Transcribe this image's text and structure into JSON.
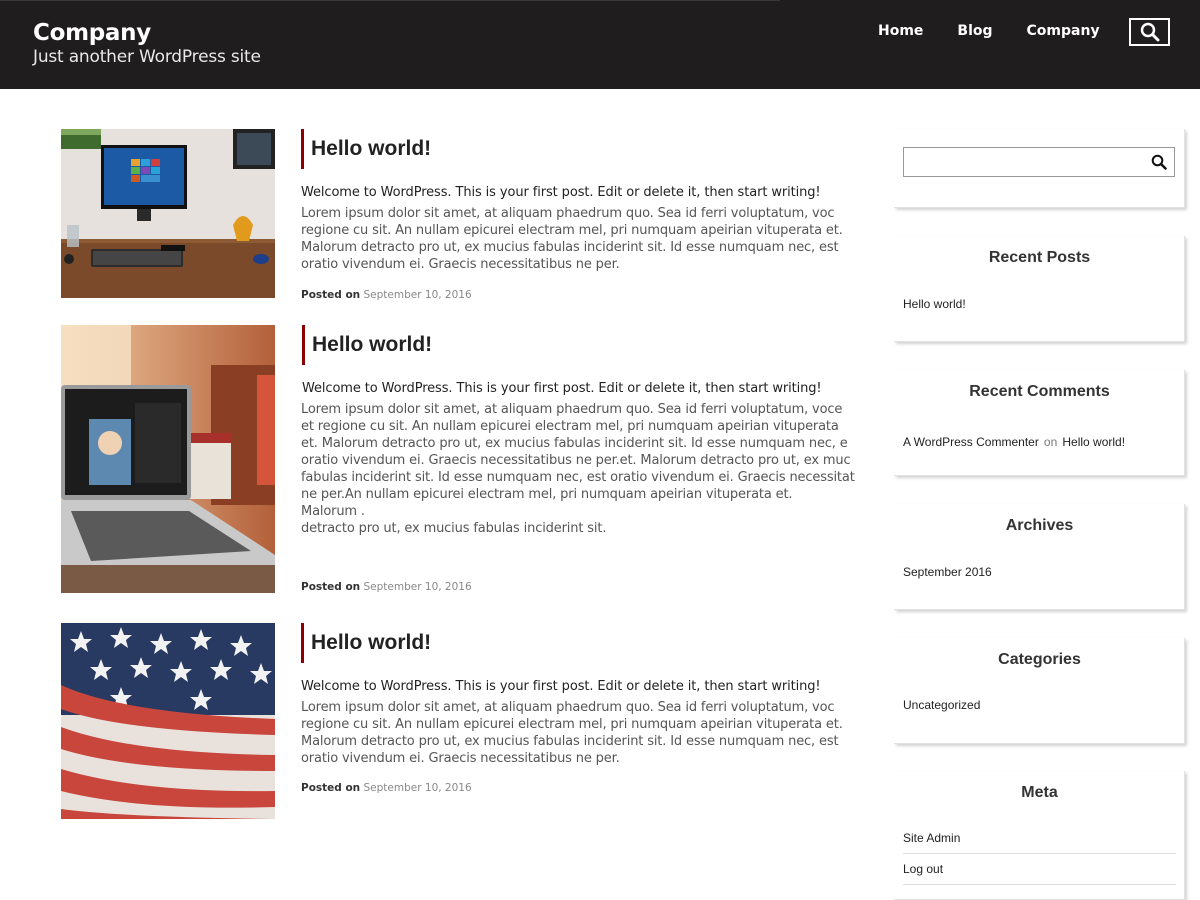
{
  "site": {
    "title": "Company",
    "tagline": "Just another WordPress site"
  },
  "nav": {
    "items": [
      "Home",
      "Blog",
      "Company"
    ],
    "search_icon": "search-icon"
  },
  "posts": [
    {
      "title": "Hello world!",
      "intro": "Welcome to WordPress. This is your first post. Edit or delete it, then start writing!",
      "body": "Lorem ipsum dolor sit amet, at aliquam phaedrum quo. Sea id ferri voluptatum, voc regione cu sit. An nullam epicurei electram mel, pri numquam apeirian vituperata et. Malorum detracto pro ut, ex mucius fabulas inciderint sit. Id esse numquam nec, est oratio vivendum ei. Graecis necessitatibus ne per.",
      "meta_label": "Posted on",
      "date": "September 10, 2016",
      "image": "desktop computer on wooden desk"
    },
    {
      "title": "Hello world!",
      "intro": "Welcome to WordPress. This is your first post. Edit or delete it, then start writing!",
      "body": "Lorem ipsum dolor sit amet, at aliquam phaedrum quo. Sea id ferri voluptatum, voce\net regione cu sit. An nullam epicurei electram mel, pri numquam apeirian vituperata\net. Malorum detracto pro ut, ex mucius fabulas inciderint sit. Id esse numquam nec, e\noratio vivendum ei. Graecis necessitatibus ne per.et. Malorum detracto pro ut, ex muc\nfabulas inciderint sit. Id esse numquam nec, est oratio vivendum ei. Graecis necessitat\nne per.An nullam epicurei electram mel, pri numquam apeirian vituperata et.\nMalorum .\ndetracto pro ut, ex mucius fabulas inciderint sit.",
      "meta_label": "Posted on",
      "date": "September 10, 2016",
      "image": "laptop on desk with calendar"
    },
    {
      "title": "Hello world!",
      "intro": "Welcome to WordPress. This is your first post. Edit or delete it, then start writing!",
      "body": "Lorem ipsum dolor sit amet, at aliquam phaedrum quo. Sea id ferri voluptatum, voc regione cu sit. An nullam epicurei electram mel, pri numquam apeirian vituperata et. Malorum detracto pro ut, ex mucius fabulas inciderint sit. Id esse numquam nec, est oratio vivendum ei. Graecis necessitatibus ne per.",
      "meta_label": "Posted on",
      "date": "September 10, 2016",
      "image": "american flag"
    }
  ],
  "sidebar": {
    "search": {
      "value": "",
      "placeholder": "",
      "icon": "search-icon"
    },
    "recent_posts": {
      "title": "Recent Posts",
      "items": [
        "Hello world!"
      ]
    },
    "recent_comments": {
      "title": "Recent Comments",
      "author": "A WordPress Commenter",
      "connector": "on",
      "post": "Hello world!"
    },
    "archives": {
      "title": "Archives",
      "items": [
        "September 2016"
      ]
    },
    "categories": {
      "title": "Categories",
      "items": [
        "Uncategorized"
      ]
    },
    "meta": {
      "title": "Meta",
      "items": [
        "Site Admin",
        "Log out"
      ]
    }
  },
  "colors": {
    "header_bg": "#1f1d1d",
    "accent": "#8b0000",
    "text": "#333333"
  }
}
